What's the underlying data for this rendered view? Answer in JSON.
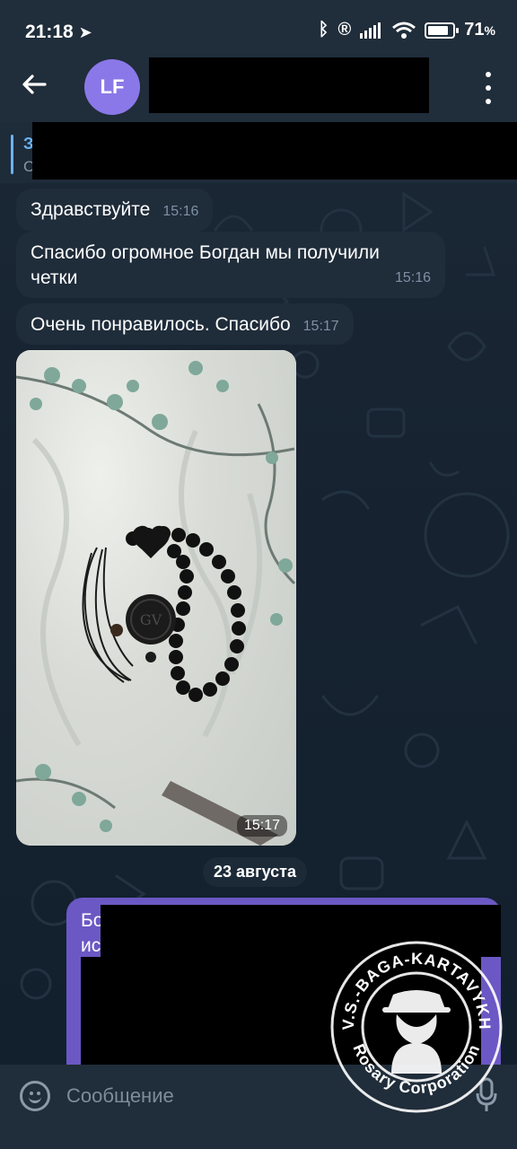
{
  "status_bar": {
    "time": "21:18",
    "battery": "71"
  },
  "header": {
    "avatar_initials": "LF",
    "contact_name": ""
  },
  "pinned": {
    "title": "З",
    "subtitle": "С"
  },
  "messages": [
    {
      "text": "Здравствуйте",
      "time": "15:16"
    },
    {
      "text": "Спасибо огромное Богдан мы получили четки",
      "time": "15:16"
    },
    {
      "text": "Очень понравилось. Спасибо",
      "time": "15:17"
    }
  ],
  "photo_message": {
    "time": "15:17",
    "pendant_text": "GV"
  },
  "date_divider": "23 августа",
  "outgoing": {
    "line1": "Бо",
    "line2": "ис"
  },
  "composer": {
    "placeholder": "Сообщение"
  },
  "watermark": {
    "top_text": "V.S.-BAGA-KARTAVYKH",
    "bottom_text": "Rosary Corporation"
  },
  "colors": {
    "header_bg": "#202d3a",
    "bubble_in": "#1f2c3a",
    "bubble_out": "#6b58c4",
    "accent": "#6ab3f3",
    "avatar": "#8a78e8"
  }
}
